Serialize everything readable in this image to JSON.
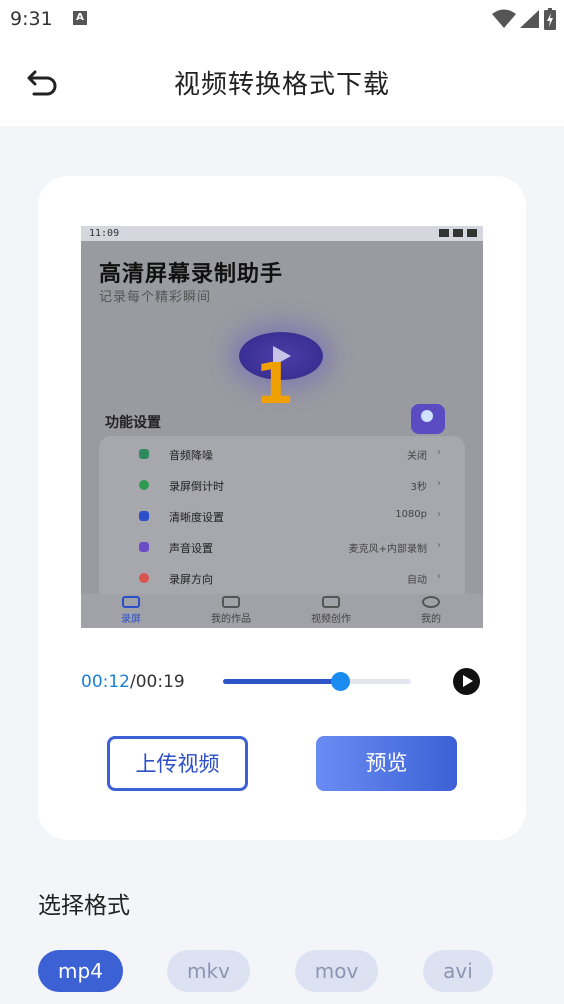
{
  "status_bar": {
    "time": "9:31",
    "notification_letter": "A",
    "icons": [
      "wifi-icon",
      "cellular-signal-icon",
      "battery-charging-icon"
    ]
  },
  "header": {
    "title": "视频转换格式下载",
    "back_icon": "back-arrow-icon"
  },
  "preview": {
    "status_time": "11:09",
    "app_title": "高清屏幕录制助手",
    "app_subtitle": "记录每个精彩瞬间",
    "countdown": "1",
    "section_title": "功能设置",
    "settings": [
      {
        "label": "音频降噪",
        "value": "关闭",
        "color": "#2f8a5f"
      },
      {
        "label": "录屏倒计时",
        "value": "3秒",
        "color": "#2f9a4f"
      },
      {
        "label": "清晰度设置",
        "value": "1080p",
        "color": "#2c4fc9"
      },
      {
        "label": "声音设置",
        "value": "麦克风+内部录制",
        "color": "#6a4cc4"
      },
      {
        "label": "录屏方向",
        "value": "自动",
        "color": "#d9534f"
      }
    ],
    "tabs": [
      {
        "label": "录屏",
        "active": true
      },
      {
        "label": "我的作品",
        "active": false
      },
      {
        "label": "视频创作",
        "active": false
      },
      {
        "label": "我的",
        "active": false
      }
    ]
  },
  "player": {
    "current_time": "00:12",
    "separator": "/",
    "total_time": "00:19",
    "progress": 0.62,
    "play_icon": "play-icon"
  },
  "actions": {
    "upload_label": "上传视频",
    "preview_label": "预览"
  },
  "format": {
    "section_title": "选择格式",
    "options": [
      "mp4",
      "mkv",
      "mov",
      "avi"
    ],
    "selected": "mp4"
  },
  "colors": {
    "accent": "#3c61d5",
    "time_current": "#1a7fd6",
    "chip_inactive_bg": "#dde2f2",
    "page_bg": "#f4f5f9"
  }
}
